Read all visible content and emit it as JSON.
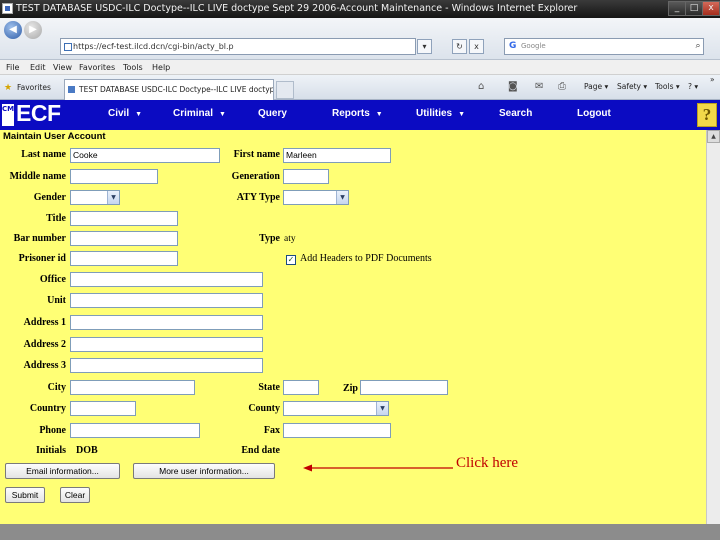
{
  "window": {
    "title": "TEST DATABASE USDC-ILC Doctype--ILC LIVE doctype Sept 29 2006-Account Maintenance - Windows Internet Explorer",
    "min_glyph": "_",
    "max_glyph": "□",
    "close_glyph": "x"
  },
  "browser": {
    "back_glyph": "◀",
    "forward_glyph": "▶",
    "url": "https://ecf-test.ilcd.dcn/cgi-bin/acty_bl.p",
    "go_glyph": "▾",
    "refresh_glyph": "↻",
    "stop_glyph": "x",
    "search_placeholder": "Google",
    "search_glyph": "⌕"
  },
  "menu": [
    "File",
    "Edit",
    "View",
    "Favorites",
    "Tools",
    "Help"
  ],
  "favbar": {
    "favorites_label": "Favorites",
    "tab_label": "TEST DATABASE USDC-ILC Doctype--ILC LIVE doctyp ...",
    "page_label": "Page ▾",
    "safety_label": "Safety ▾",
    "tools_label": "Tools ▾",
    "help_label": "? ▾",
    "more_label": "»"
  },
  "ecf": {
    "logo_mark": "CM",
    "logo_text": "ECF",
    "nav": {
      "civil": "Civil",
      "criminal": "Criminal",
      "query": "Query",
      "reports": "Reports",
      "utilities": "Utilities",
      "search": "Search",
      "logout": "Logout"
    },
    "dropdown_glyph": "▼",
    "help_glyph": "?"
  },
  "form": {
    "heading": "Maintain User Account",
    "labels": {
      "last_name": "Last name",
      "first_name": "First name",
      "middle_name": "Middle name",
      "generation": "Generation",
      "gender": "Gender",
      "aty_type": "ATY Type",
      "title": "Title",
      "bar_number": "Bar number",
      "type": "Type",
      "prisoner_id": "Prisoner id",
      "office": "Office",
      "unit": "Unit",
      "address1": "Address 1",
      "address2": "Address 2",
      "address3": "Address 3",
      "city": "City",
      "state": "State",
      "zip": "Zip",
      "country": "Country",
      "county": "County",
      "phone": "Phone",
      "fax": "Fax",
      "initials": "Initials",
      "dob": "DOB",
      "end_date": "End date"
    },
    "values": {
      "last_name": "Cooke",
      "first_name": "Marleen",
      "type": "aty"
    },
    "pdf_checkbox_label": "Add Headers to PDF Documents",
    "check_glyph": "✓",
    "select_glyph": "▼",
    "buttons": {
      "email_info": "Email information...",
      "more_user_info": "More user information...",
      "submit": "Submit",
      "clear": "Clear"
    }
  },
  "annotation": {
    "text": "Click here",
    "color": "#c00000"
  },
  "scroll_up_glyph": "▲"
}
